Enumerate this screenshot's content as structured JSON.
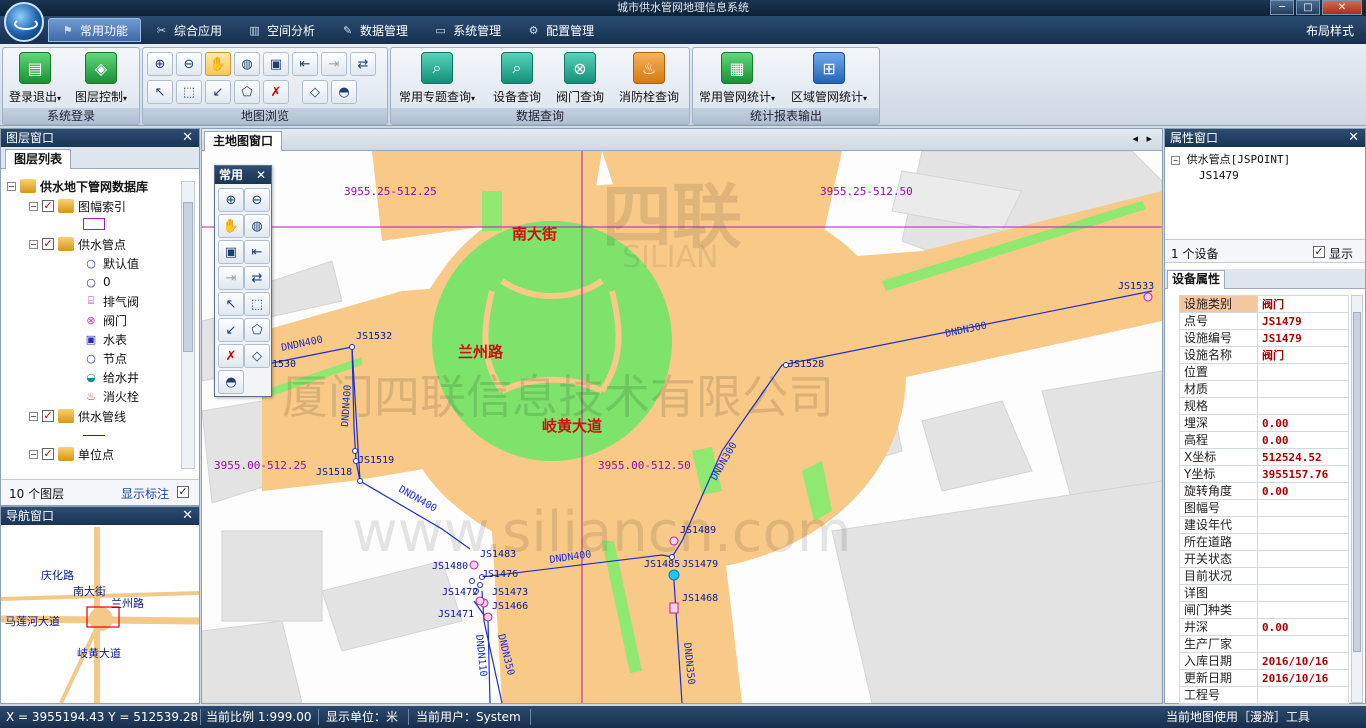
{
  "window": {
    "title": "城市供水管网地理信息系统",
    "min": "─",
    "max": "□",
    "close": "✕"
  },
  "menubar": {
    "items": [
      {
        "label": "常用功能",
        "icon": "flag-icon"
      },
      {
        "label": "综合应用",
        "icon": "tools-icon"
      },
      {
        "label": "空间分析",
        "icon": "chart-icon"
      },
      {
        "label": "数据管理",
        "icon": "pencil-icon"
      },
      {
        "label": "系统管理",
        "icon": "monitor-icon"
      },
      {
        "label": "配置管理",
        "icon": "gear-icon"
      }
    ],
    "layout_style": "布局样式"
  },
  "ribbon": {
    "login": {
      "title": "系统登录",
      "logout": "登录退出",
      "layers": "图层控制"
    },
    "browse": {
      "title": "地图浏览"
    },
    "query": {
      "title": "数据查询",
      "thematic": "常用专题查询",
      "device": "设备查询",
      "valve": "阀门查询",
      "hydrant": "消防栓查询"
    },
    "stats": {
      "title": "统计报表输出",
      "common": "常用管网统计",
      "region": "区域管网统计"
    }
  },
  "left": {
    "title": "图层窗口",
    "tab": "图层列表",
    "tree": {
      "root": "供水地下管网数据库",
      "sheet": "图幅索引",
      "points": "供水管点",
      "default": "默认值",
      "zero": "0",
      "vent": "排气阀",
      "valve": "阀门",
      "meter": "水表",
      "node": "节点",
      "well": "给水井",
      "hydrant": "消火栓",
      "lines": "供水管线",
      "units": "单位点"
    },
    "layer_count": "10 个图层",
    "show_label": "显示标注"
  },
  "nav": {
    "title": "导航窗口",
    "roads": {
      "qinghua": "庆化路",
      "nandajie": "南大街",
      "lanzhou": "兰州路",
      "malianhe": "马莲河大道",
      "qihuang": "岐黄大道"
    }
  },
  "map": {
    "tab": "主地图窗口",
    "toolbar_title": "常用",
    "grid": {
      "tl": "3955.25-512.25",
      "tr": "3955.25-512.50",
      "bl": "3955.00-512.25",
      "br": "3955.00-512.50"
    },
    "roads": {
      "nandajie": "南大街",
      "lanzhou": "兰州路",
      "qihuang": "岐黄大道"
    },
    "pipes": {
      "dn400a": "DNDN400",
      "dn400b": "DNDN400",
      "dn400c": "DNDN400",
      "dn400d": "DNDN400",
      "dn300a": "DNDN300",
      "dn300b": "DNDN300",
      "dn110": "DNDN110",
      "dn350a": "DNDN350",
      "dn350b": "DNDN350"
    },
    "points": {
      "p1533": "JS1533",
      "p1532": "JS1532",
      "p1530": "1530",
      "p1528": "JS1528",
      "p1519": "JS1519",
      "p1518": "JS1518",
      "p1489": "JS1489",
      "p1483": "JS1483",
      "p1480": "JS1480",
      "p1476": "JS1476",
      "p1485": "JS1485",
      "p1479": "JS1479",
      "p1472": "JS1472",
      "p1473": "JS1473",
      "p1468": "JS1468",
      "p1466": "JS1466",
      "p1471": "JS1471"
    },
    "watermark_company": "厦门四联信息技术有限公司",
    "watermark_url": "www.silian​cn.com",
    "watermark_logo": "四联",
    "watermark_logo_sub": "SILIAN"
  },
  "right": {
    "title": "属性窗口",
    "tree_root": "供水管点[JSPOINT]",
    "tree_child": "JS1479",
    "count": "1 个设备",
    "show": "显示",
    "tab": "设备属性",
    "props": [
      {
        "k": "设施类别",
        "v": "阀门"
      },
      {
        "k": "点号",
        "v": "JS1479"
      },
      {
        "k": "设施编号",
        "v": "JS1479"
      },
      {
        "k": "设施名称",
        "v": "阀门"
      },
      {
        "k": "位置",
        "v": ""
      },
      {
        "k": "材质",
        "v": ""
      },
      {
        "k": "规格",
        "v": ""
      },
      {
        "k": "埋深",
        "v": "0.00"
      },
      {
        "k": "高程",
        "v": "0.00"
      },
      {
        "k": "X坐标",
        "v": "512524.52"
      },
      {
        "k": "Y坐标",
        "v": "3955157.76"
      },
      {
        "k": "旋转角度",
        "v": "0.00"
      },
      {
        "k": "图幅号",
        "v": ""
      },
      {
        "k": "建设年代",
        "v": ""
      },
      {
        "k": "所在道路",
        "v": ""
      },
      {
        "k": "开关状态",
        "v": ""
      },
      {
        "k": "目前状况",
        "v": ""
      },
      {
        "k": "详图",
        "v": ""
      },
      {
        "k": "闸门种类",
        "v": ""
      },
      {
        "k": "井深",
        "v": "0.00"
      },
      {
        "k": "生产厂家",
        "v": ""
      },
      {
        "k": "入库日期",
        "v": "2016/10/16"
      },
      {
        "k": "更新日期",
        "v": "2016/10/16"
      },
      {
        "k": "工程号",
        "v": ""
      }
    ]
  },
  "status": {
    "coords": "X = 3955194.43  Y = 512539.28",
    "scale": "当前比例 1:999.00",
    "unit": "显示单位：米",
    "user": "当前用户：System",
    "tool": "当前地图使用［漫游］工具"
  }
}
